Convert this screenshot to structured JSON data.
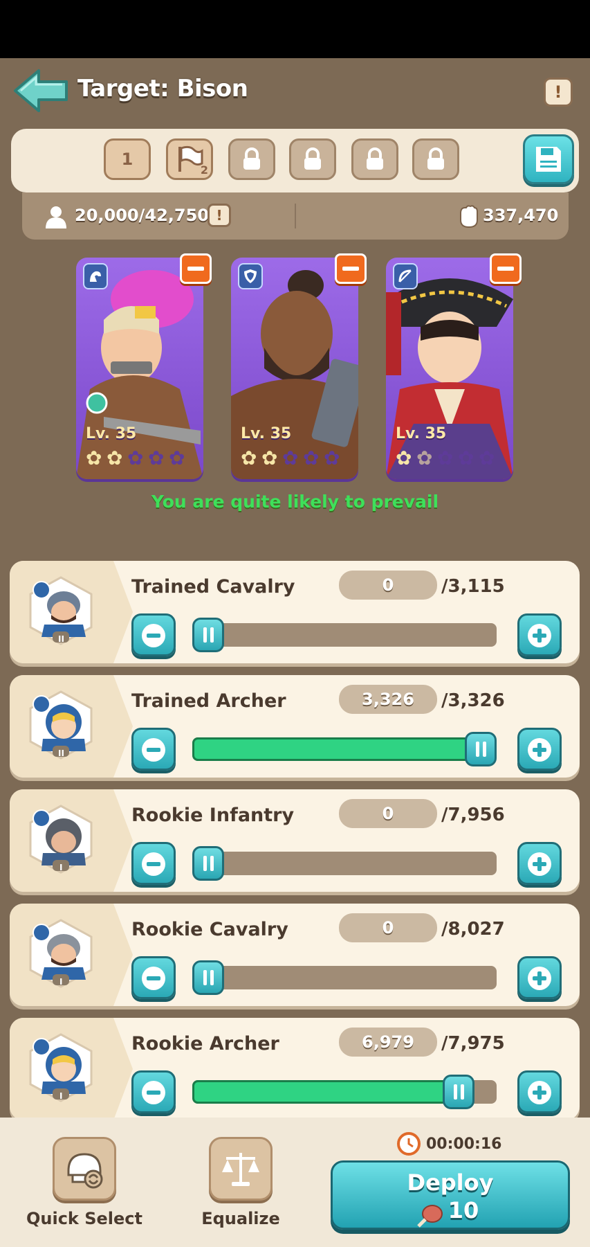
{
  "header": {
    "title": "Target: Bison",
    "info_glyph": "!"
  },
  "slots": [
    {
      "label": "1",
      "state": "selected"
    },
    {
      "label": "2",
      "icon": "flag-icon",
      "state": "active"
    },
    {
      "label": "",
      "icon": "lock-icon",
      "state": "locked"
    },
    {
      "label": "",
      "icon": "lock-icon",
      "state": "locked"
    },
    {
      "label": "",
      "icon": "lock-icon",
      "state": "locked"
    },
    {
      "label": "",
      "icon": "lock-icon",
      "state": "locked"
    }
  ],
  "stats": {
    "troops": "20,000/42,750",
    "warn_glyph": "!",
    "power": "337,470"
  },
  "heroes": [
    {
      "level": "Lv. 35",
      "type_icon": "cavalry-icon",
      "stars": 2,
      "color": "#8b5bd8"
    },
    {
      "level": "Lv. 35",
      "type_icon": "shield-icon",
      "stars": 2,
      "color": "#8b5bd8"
    },
    {
      "level": "Lv. 35",
      "type_icon": "bow-icon",
      "stars": 1.5,
      "color": "#8b5bd8"
    }
  ],
  "prediction": "You are quite likely to prevail",
  "troops": [
    {
      "name": "Trained Cavalry",
      "count": "0",
      "max": "/3,115",
      "fill": 0.0,
      "type_icon": "cavalry-icon",
      "tier": "II"
    },
    {
      "name": "Trained Archer",
      "count": "3,326",
      "max": "/3,326",
      "fill": 1.0,
      "type_icon": "bow-icon",
      "tier": "II"
    },
    {
      "name": "Rookie Infantry",
      "count": "0",
      "max": "/7,956",
      "fill": 0.0,
      "type_icon": "shield-icon",
      "tier": "I"
    },
    {
      "name": "Rookie Cavalry",
      "count": "0",
      "max": "/8,027",
      "fill": 0.0,
      "type_icon": "cavalry-icon",
      "tier": "I"
    },
    {
      "name": "Rookie Archer",
      "count": "6,979",
      "max": "/7,975",
      "fill": 0.875,
      "type_icon": "bow-icon",
      "tier": "I"
    }
  ],
  "footer": {
    "quick_select": "Quick Select",
    "equalize": "Equalize",
    "timer": "00:00:16",
    "deploy": "Deploy",
    "deploy_cost": "10"
  },
  "colors": {
    "background": "#7d6a55",
    "accent_teal": "#2fb3c0",
    "success_green": "#3ee05a",
    "hero_purple": "#8b5bd8",
    "remove_orange": "#f06a1e"
  }
}
